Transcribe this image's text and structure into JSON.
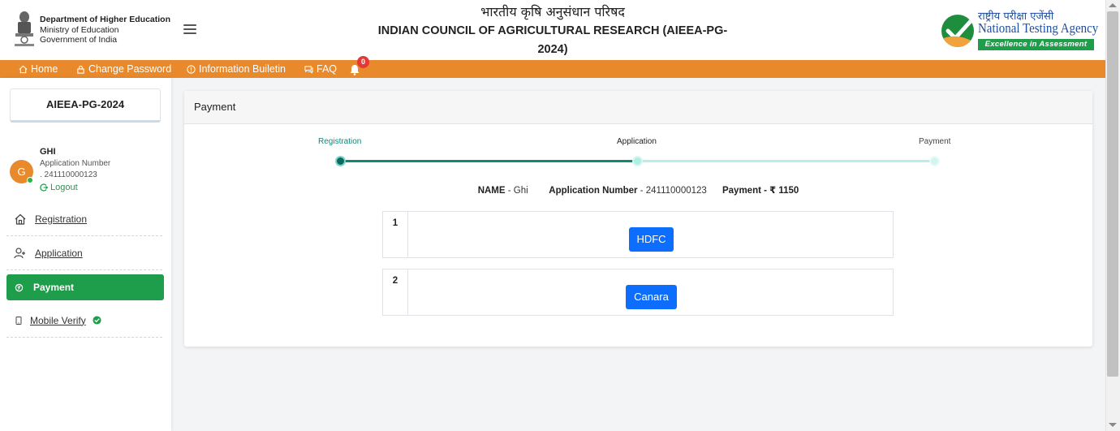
{
  "header": {
    "dept_title": "Department of Higher Education",
    "ministry": "Ministry of Education",
    "government": "Government of India",
    "title_hindi": "भारतीय कृषि अनुसंधान परिषद",
    "title_english": "INDIAN COUNCIL OF AGRICULTURAL RESEARCH (AIEEA-PG-2024)",
    "nta_hindi": "राष्ट्रीय परीक्षा एजेंसी",
    "nta_english": "National Testing Agency",
    "nta_tagline": "Excellence in Assessment"
  },
  "nav": {
    "items": [
      "Home",
      "Change Password",
      "Information Builetin",
      "FAQ"
    ],
    "notification_count": "0"
  },
  "sidebar": {
    "exam_name": "AIEEA-PG-2024",
    "avatar_letter": "G",
    "user_name": "GHI",
    "app_number_label": "Application Number",
    "app_number_value": ". 241110000123",
    "logout_label": "Logout",
    "links": [
      "Registration",
      "Application",
      "Payment",
      "Mobile Verify"
    ]
  },
  "panel": {
    "title": "Payment",
    "steps": [
      "Registration",
      "Application",
      "Payment"
    ],
    "summary": {
      "name_label": "NAME",
      "name_value": "Ghi",
      "app_label": "Application Number",
      "app_value": "241110000123",
      "payment_label": "Payment - ₹ 1150"
    },
    "banks": [
      {
        "index": "1",
        "label": "HDFC"
      },
      {
        "index": "2",
        "label": "Canara"
      }
    ]
  },
  "colors": {
    "nav_orange": "#e8892b",
    "active_green": "#1e9e4a",
    "step_teal": "#11877a",
    "step_light": "#b6efe6",
    "bank_blue": "#0d6efd"
  }
}
